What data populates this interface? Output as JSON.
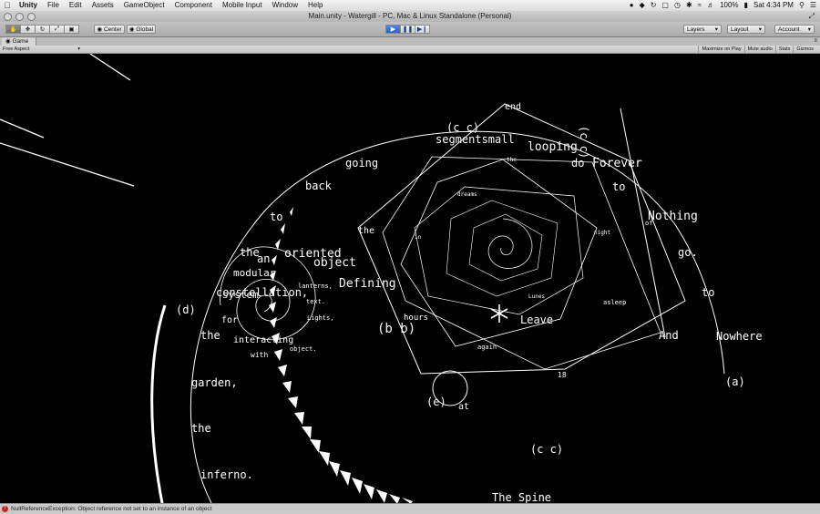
{
  "menubar": {
    "app_name": "Unity",
    "items": [
      "File",
      "Edit",
      "Assets",
      "GameObject",
      "Component",
      "Mobile Input",
      "Window",
      "Help"
    ],
    "battery": "100%",
    "clock": "Sat 4:34 PM"
  },
  "window": {
    "title": "Main.unity - Watergill - PC, Mac & Linux Standalone (Personal)"
  },
  "toolbar": {
    "pivot_label": "Center",
    "space_label": "Global",
    "layers_label": "Layers",
    "layout_label": "Layout",
    "account_label": "Account"
  },
  "tabs": {
    "game_label": "Game"
  },
  "gameview": {
    "aspect_label": "Free Aspect",
    "maximize_label": "Maximize on Play",
    "mute_label": "Mute audio",
    "stats_label": "Stats",
    "gizmos_label": "Gizmos"
  },
  "scene_words": {
    "w01": "end",
    "w02": "(c c)",
    "w03": "segmentsmall",
    "w04": "looping",
    "w05": "(c c)",
    "w06": "do",
    "w07": "Forever",
    "w08": "going",
    "w09": "to",
    "w10": "back",
    "w11": "Nothing",
    "w12": "to",
    "w13": "the",
    "w14": "go.",
    "w15": "the",
    "w16": "an",
    "w17": "oriented",
    "w18": "object",
    "w19": "modular",
    "w20": "Defining",
    "w21": "constellation,",
    "w22": "to",
    "w23": "(d)",
    "w24": "system",
    "w25": "for",
    "w26": "hours",
    "w27": "(b b)",
    "w28": "Leave",
    "w29": "the",
    "w30": "interacting",
    "w31": "And",
    "w32": "Nowhere",
    "w33": "again",
    "w34": "asleep",
    "w35": "18",
    "w36": "(a)",
    "w37": "garden,",
    "w38": "(e)",
    "w39": "at",
    "w40": "the",
    "w41": "(c c)",
    "w42": "inferno.",
    "w43": "The Spine",
    "w44": "Lights,",
    "w45": "lanterns,",
    "w46": "text.",
    "w47": "object.",
    "w48": "with",
    "w49": "night",
    "w50": "of",
    "w51": "the",
    "w52": "dreams",
    "w53": "in",
    "w54": "Lunes"
  },
  "status_bar": {
    "message": "NullReferenceException: Object reference not set to an instance of an object"
  }
}
